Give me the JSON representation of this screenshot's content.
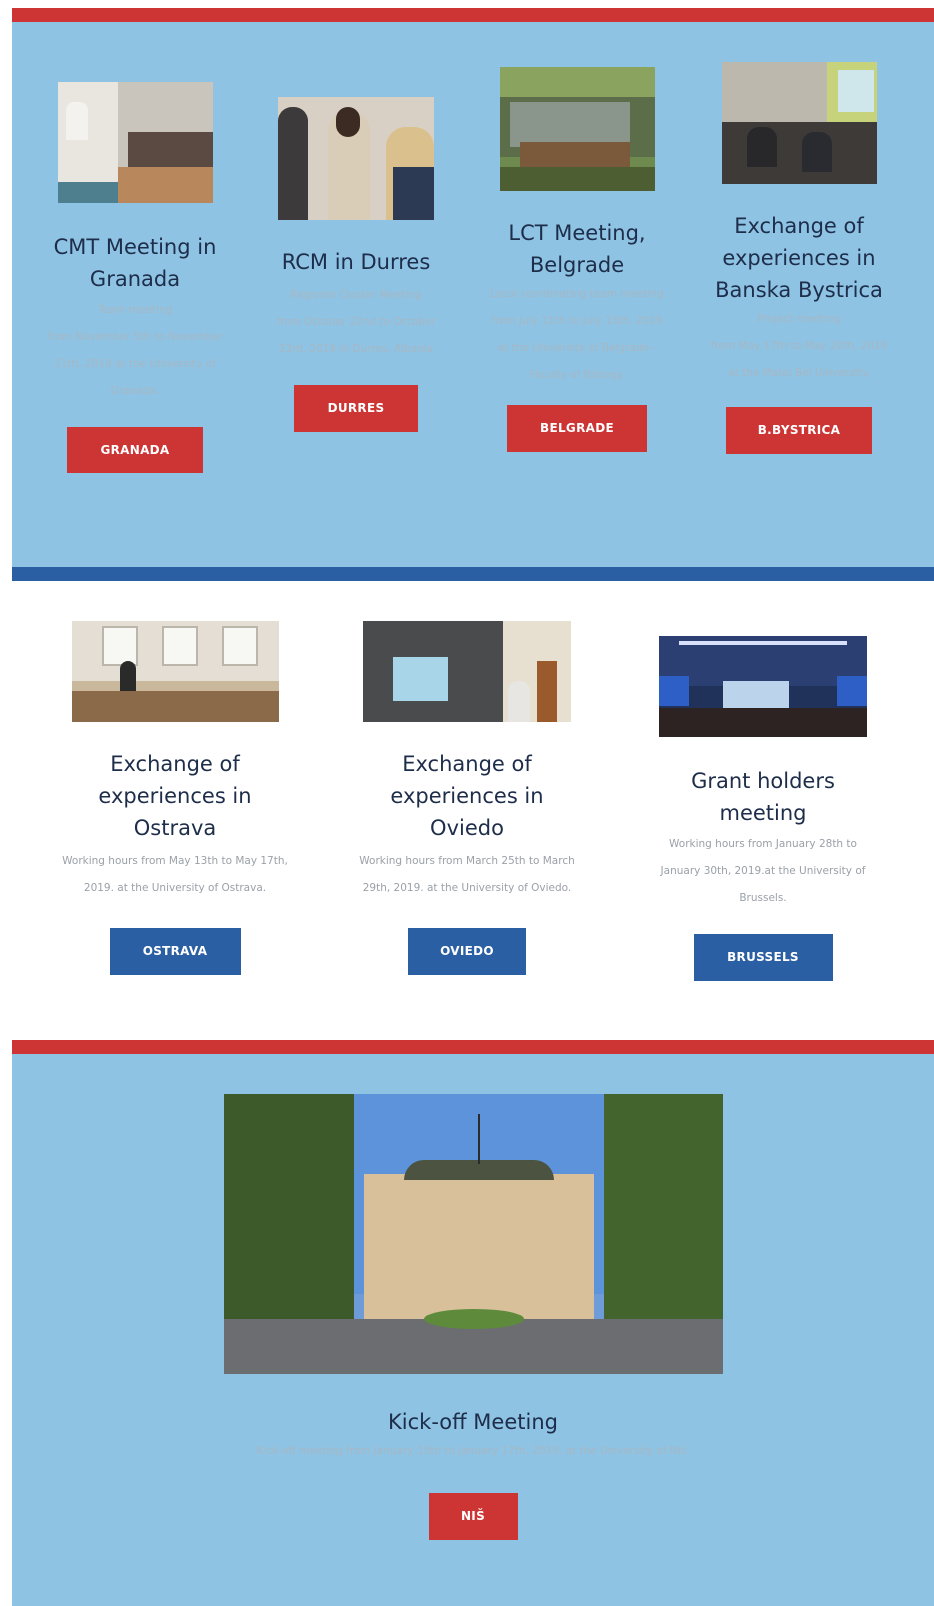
{
  "section1": {
    "cards": [
      {
        "title": "CMT Meeting in Granada",
        "desc": [
          "Team meeting",
          "from November 5th to November 11th, 2019 at the University of Granada."
        ],
        "button": "GRANADA",
        "photo_icon": "meeting-room-photo"
      },
      {
        "title": "RCM in Durres",
        "desc": [
          "Regional Cluster Meeting",
          "from October 22nd to October 23rd, 2019 in Durres, Albania"
        ],
        "button": "DURRES",
        "photo_icon": "people-photo"
      },
      {
        "title": "LCT Meeting, Belgrade",
        "desc": [
          "Local coordinating team meeting",
          "from July 11th to July 13th, 2019 at the University of Belgrade - Faculty of Biology."
        ],
        "button": "BELGRADE",
        "photo_icon": "outdoor-group-photo"
      },
      {
        "title": "Exchange of experiences in Banska Bystrica",
        "desc": [
          "Project meeting",
          "from May 17th to May 20th, 2019 at the Matej Bel University."
        ],
        "button": "B.BYSTRICA",
        "photo_icon": "classroom-photo"
      }
    ]
  },
  "section2": {
    "cards": [
      {
        "title": "Exchange of experiences in Ostrava",
        "desc": "Working hours from May 13th to May 17th, 2019. at the University of Ostrava.",
        "button": "OSTRAVA",
        "photo_icon": "lab-photo"
      },
      {
        "title": "Exchange of experiences in Oviedo",
        "desc": "Working hours from March 25th to March 29th, 2019. at the University of Oviedo.",
        "button": "OVIEDO",
        "photo_icon": "presentation-photo"
      },
      {
        "title": "Grant holders meeting",
        "desc": "Working hours from January 28th to January 30th, 2019.at the University of Brussels.",
        "button": "BRUSSELS",
        "photo_icon": "auditorium-photo"
      }
    ]
  },
  "section3": {
    "title": "Kick-off Meeting",
    "desc": "Kick-off meeting from January 15th to January 17th, 2019. at the University of Niš.",
    "button": "NIŠ",
    "photo_icon": "university-building-photo"
  },
  "colors": {
    "red": "#cd3434",
    "blue": "#2b5fa3",
    "light_blue": "#8ec3e3"
  }
}
